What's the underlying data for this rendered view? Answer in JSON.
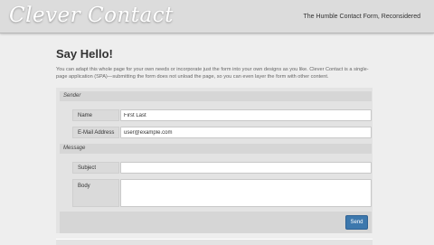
{
  "header": {
    "logo": "Clever Contact",
    "tagline": "The Humble Contact Form, Reconsidered"
  },
  "main": {
    "title": "Say Hello!",
    "intro": "You can adapt this whole page for your own needs or incorporate just the form into your own designs as you like. Clever Contact is a single-page application (SPA)—submitting the form does not unload the page, so you can even layer the form with other content."
  },
  "form": {
    "sender_legend": "Sender",
    "name_label": "Name",
    "name_value": "First Last",
    "email_label": "E-Mail Address",
    "email_value": "user@example.com",
    "message_legend": "Message",
    "subject_label": "Subject",
    "subject_value": "",
    "body_label": "Body",
    "body_value": "",
    "send_label": "Send"
  },
  "colors": {
    "accent": "#3d78ad",
    "background": "#eeeeee",
    "header": "#dcdcdc"
  }
}
